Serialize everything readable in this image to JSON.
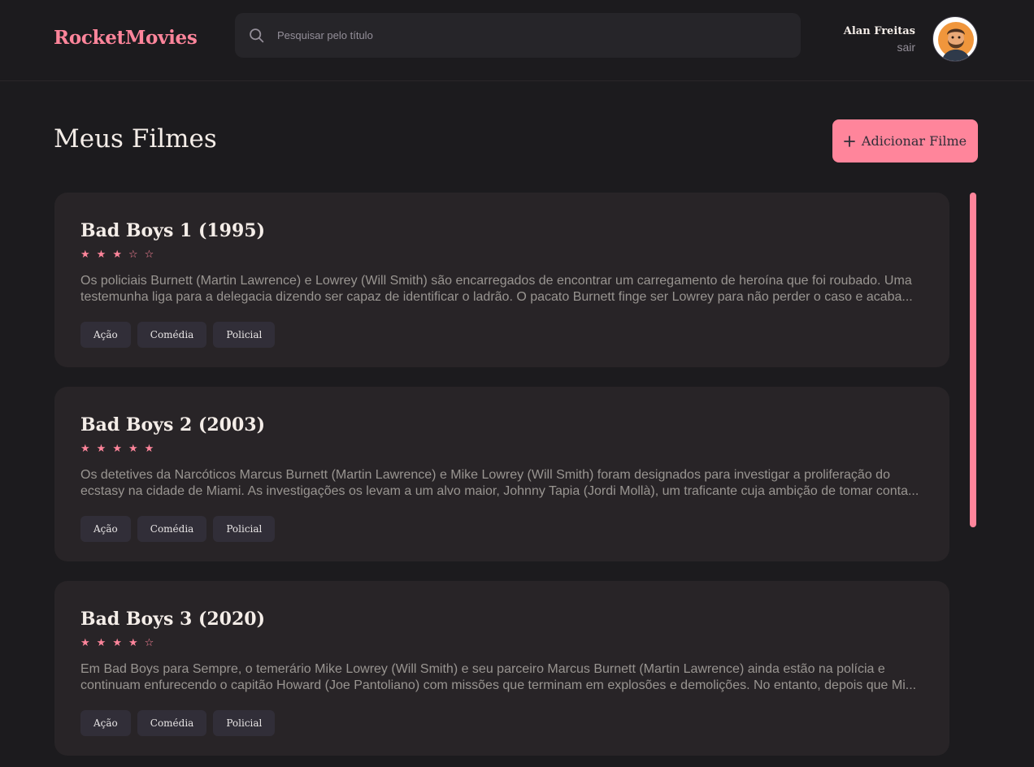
{
  "header": {
    "logo": "RocketMovies",
    "search": {
      "placeholder": "Pesquisar pelo título"
    },
    "profile": {
      "name": "Alan Freitas",
      "logout_label": "sair"
    }
  },
  "main": {
    "title": "Meus Filmes",
    "add_button_label": "Adicionar Filme",
    "movies": [
      {
        "title": "Bad Boys 1 (1995)",
        "rating": 3,
        "stars": [
          "★",
          "★",
          "★",
          "☆",
          "☆"
        ],
        "description": "Os policiais Burnett (Martin Lawrence) e Lowrey (Will Smith) são encarregados de encontrar um carregamento de heroína que foi roubado. Uma testemunha liga para a delegacia dizendo ser capaz de identificar o ladrão. O pacato Burnett finge ser Lowrey para não perder o caso e acaba...",
        "tags": [
          "Ação",
          "Comédia",
          "Policial"
        ]
      },
      {
        "title": "Bad Boys 2 (2003)",
        "rating": 5,
        "stars": [
          "★",
          "★",
          "★",
          "★",
          "★"
        ],
        "description": "Os detetives da Narcóticos Marcus Burnett (Martin Lawrence) e Mike Lowrey (Will Smith) foram designados para investigar a proliferação do ecstasy na cidade de Miami. As investigações os levam a um alvo maior, Johnny Tapia (Jordi Mollà), um traficante cuja ambição de tomar conta...",
        "tags": [
          "Ação",
          "Comédia",
          "Policial"
        ]
      },
      {
        "title": "Bad Boys 3 (2020)",
        "rating": 4,
        "stars": [
          "★",
          "★",
          "★",
          "★",
          "☆"
        ],
        "description": "Em Bad Boys para Sempre, o temerário Mike Lowrey (Will Smith) e seu parceiro Marcus Burnett (Martin Lawrence) ainda estão na polícia e continuam enfurecendo o capitão Howard (Joe Pantoliano) com missões que terminam em explosões e demolições. No entanto, depois que Mi...",
        "tags": [
          "Ação",
          "Comédia",
          "Policial"
        ]
      }
    ]
  },
  "colors": {
    "accent": "#ff859b",
    "background": "#1c1b1e",
    "card": "#282427",
    "tag": "#312e38"
  },
  "icons": {
    "search": "search-icon",
    "add": "plus-icon",
    "avatar": "avatar"
  }
}
